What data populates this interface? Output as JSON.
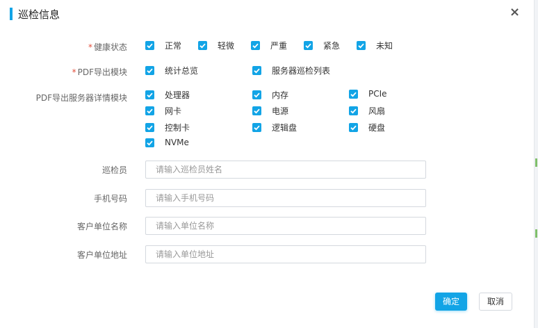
{
  "dialog": {
    "title": "巡检信息",
    "close_label": "×"
  },
  "health": {
    "label": "健康状态",
    "required": "*",
    "options": [
      "正常",
      "轻微",
      "严重",
      "紧急",
      "未知"
    ]
  },
  "pdf_module": {
    "label": "PDF导出模块",
    "required": "*",
    "options": [
      "统计总览",
      "服务器巡检列表"
    ]
  },
  "server_detail": {
    "label": "PDF导出服务器详情模块",
    "options": [
      "处理器",
      "内存",
      "PCIe",
      "网卡",
      "电源",
      "风扇",
      "控制卡",
      "逻辑盘",
      "硬盘",
      "NVMe"
    ]
  },
  "form": {
    "inspector": {
      "label": "巡检员",
      "placeholder": "请输入巡检员姓名",
      "value": ""
    },
    "phone": {
      "label": "手机号码",
      "placeholder": "请输入手机号码",
      "value": ""
    },
    "customer_name": {
      "label": "客户单位名称",
      "placeholder": "请输入单位名称",
      "value": ""
    },
    "customer_address": {
      "label": "客户单位地址",
      "placeholder": "请输入单位地址",
      "value": ""
    }
  },
  "buttons": {
    "confirm": "确定",
    "cancel": "取消"
  },
  "colors": {
    "accent": "#12a4e6",
    "required": "#e24d3a"
  }
}
